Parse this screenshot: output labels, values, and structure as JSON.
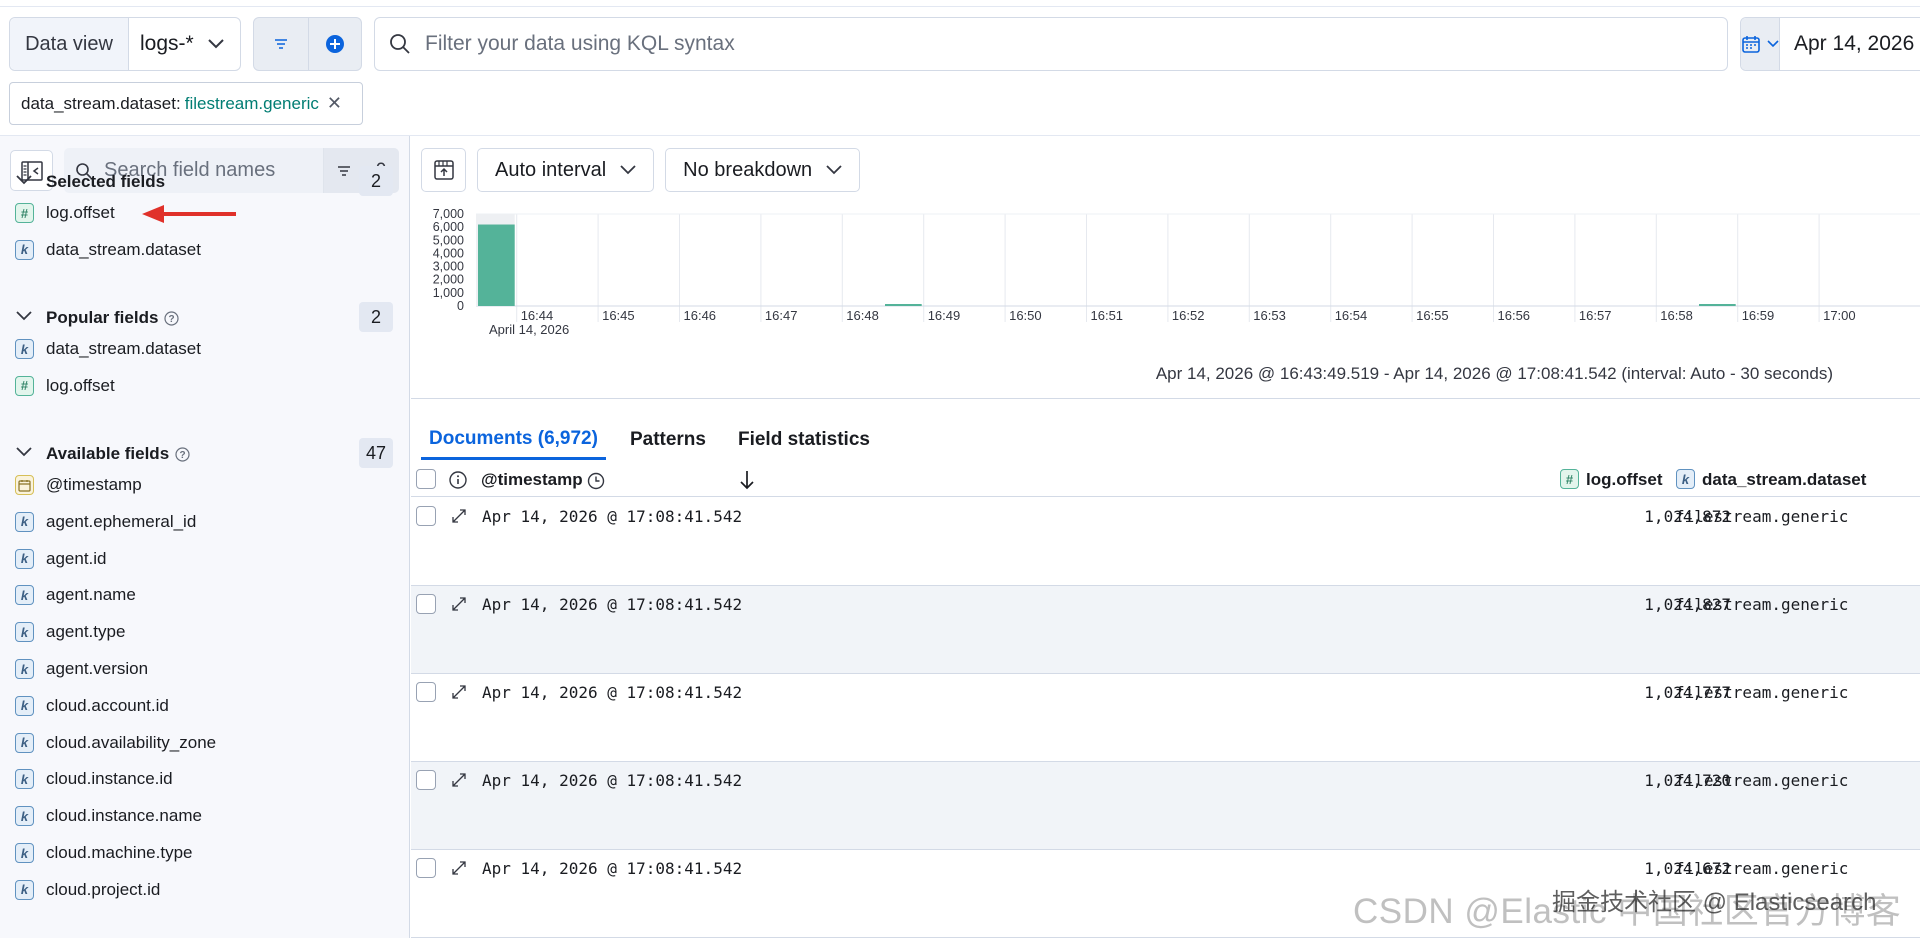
{
  "query_bar": {
    "data_view_label": "Data view",
    "data_view_value": "logs-*",
    "kql_placeholder": "Filter your data using KQL syntax",
    "date_start": "Apr 14, 2026 @ 16:43:49.519"
  },
  "filter_pill": {
    "key": "data_stream.dataset:",
    "value": "filestream.generic"
  },
  "sidebar": {
    "search_placeholder": "Search field names",
    "filter_count": "0",
    "selected": {
      "title": "Selected fields",
      "count": "2",
      "fields": [
        {
          "name": "log.offset",
          "type": "#"
        },
        {
          "name": "data_stream.dataset",
          "type": "k"
        }
      ]
    },
    "popular": {
      "title": "Popular fields",
      "count": "2",
      "fields": [
        {
          "name": "data_stream.dataset",
          "type": "k"
        },
        {
          "name": "log.offset",
          "type": "#"
        }
      ]
    },
    "available": {
      "title": "Available fields",
      "count": "47",
      "fields": [
        {
          "name": "@timestamp",
          "type": "date"
        },
        {
          "name": "agent.ephemeral_id",
          "type": "k"
        },
        {
          "name": "agent.id",
          "type": "k"
        },
        {
          "name": "agent.name",
          "type": "k"
        },
        {
          "name": "agent.type",
          "type": "k"
        },
        {
          "name": "agent.version",
          "type": "k"
        },
        {
          "name": "cloud.account.id",
          "type": "k"
        },
        {
          "name": "cloud.availability_zone",
          "type": "k"
        },
        {
          "name": "cloud.instance.id",
          "type": "k"
        },
        {
          "name": "cloud.instance.name",
          "type": "k"
        },
        {
          "name": "cloud.machine.type",
          "type": "k"
        },
        {
          "name": "cloud.project.id",
          "type": "k"
        }
      ]
    }
  },
  "toolbar": {
    "interval": "Auto interval",
    "breakdown": "No breakdown"
  },
  "chart_data": {
    "type": "bar",
    "y_ticks": [
      "7,000",
      "6,000",
      "5,000",
      "4,000",
      "3,000",
      "2,000",
      "1,000",
      "0"
    ],
    "ylim": [
      0,
      7000
    ],
    "x_ticks": [
      "16:44",
      "16:45",
      "16:46",
      "16:47",
      "16:48",
      "16:49",
      "16:50",
      "16:51",
      "16:52",
      "16:53",
      "16:54",
      "16:55",
      "16:56",
      "16:57",
      "16:58",
      "16:59",
      "17:00"
    ],
    "x_sublabel": "April 14, 2026",
    "bars": [
      {
        "start": "16:43:30",
        "value": 6200
      },
      {
        "start": "16:48:30",
        "value": 40
      },
      {
        "start": "16:58:30",
        "value": 40
      }
    ],
    "bar_color": "#54b399"
  },
  "range_text": "Apr 14, 2026 @ 16:43:49.519 - Apr 14, 2026 @ 17:08:41.542 (interval: Auto - 30 seconds)",
  "tabs": [
    "Documents (6,972)",
    "Patterns",
    "Field statistics"
  ],
  "grid": {
    "columns": [
      "@timestamp",
      "log.offset",
      "data_stream.dataset"
    ],
    "rows": [
      {
        "timestamp": "Apr 14, 2026 @ 17:08:41.542",
        "offset": "1,024,872",
        "dataset": "filestream.generic"
      },
      {
        "timestamp": "Apr 14, 2026 @ 17:08:41.542",
        "offset": "1,024,827",
        "dataset": "filestream.generic"
      },
      {
        "timestamp": "Apr 14, 2026 @ 17:08:41.542",
        "offset": "1,024,777",
        "dataset": "filestream.generic"
      },
      {
        "timestamp": "Apr 14, 2026 @ 17:08:41.542",
        "offset": "1,024,720",
        "dataset": "filestream.generic"
      },
      {
        "timestamp": "Apr 14, 2026 @ 17:08:41.542",
        "offset": "1,024,672",
        "dataset": "filestream.generic"
      }
    ]
  },
  "watermark": "CSDN @Elastic 中国社区官方博客",
  "watermark2": "掘金技术社区 @ Elasticsearch",
  "colors": {
    "accent": "#0b64dd",
    "bar": "#54b399",
    "annotation_arrow": "#e0312a"
  }
}
